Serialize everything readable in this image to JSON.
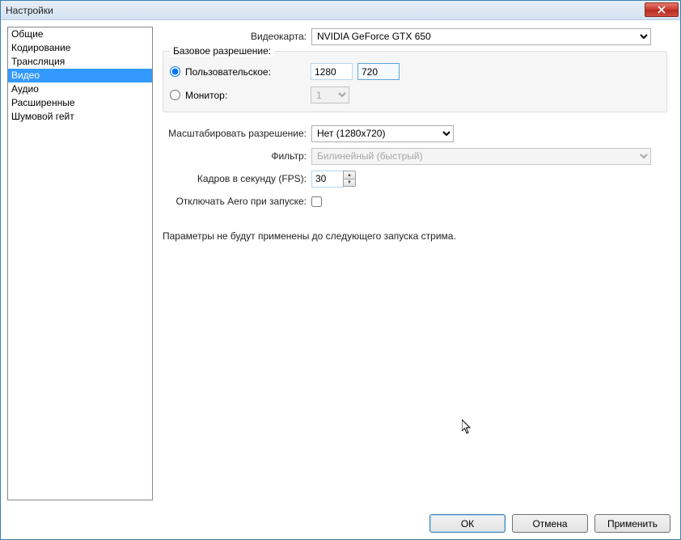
{
  "window": {
    "title": "Настройки"
  },
  "sidebar": {
    "items": [
      {
        "label": "Общие",
        "selected": false
      },
      {
        "label": "Кодирование",
        "selected": false
      },
      {
        "label": "Трансляция",
        "selected": false
      },
      {
        "label": "Видео",
        "selected": true
      },
      {
        "label": "Аудио",
        "selected": false
      },
      {
        "label": "Расширенные",
        "selected": false
      },
      {
        "label": "Шумовой гейт",
        "selected": false
      }
    ]
  },
  "video": {
    "gpu_label": "Видеокарта:",
    "gpu_value": "NVIDIA GeForce GTX 650",
    "group_title": "Базовое разрешение:",
    "radio_custom": "Пользовательское:",
    "res_w": "1280",
    "res_h": "720",
    "radio_monitor": "Монитор:",
    "monitor_value": "1",
    "scale_label": "Масштабировать разрешение:",
    "scale_value": "Нет  (1280x720)",
    "filter_label": "Фильтр:",
    "filter_value": "Билинейный (быстрый)",
    "fps_label": "Кадров в секунду (FPS):",
    "fps_value": "30",
    "aero_label": "Отключать Aero при запуске:",
    "note": "Параметры не будут применены до следующего запуска стрима."
  },
  "footer": {
    "ok": "ОК",
    "cancel": "Отмена",
    "apply": "Применить"
  }
}
